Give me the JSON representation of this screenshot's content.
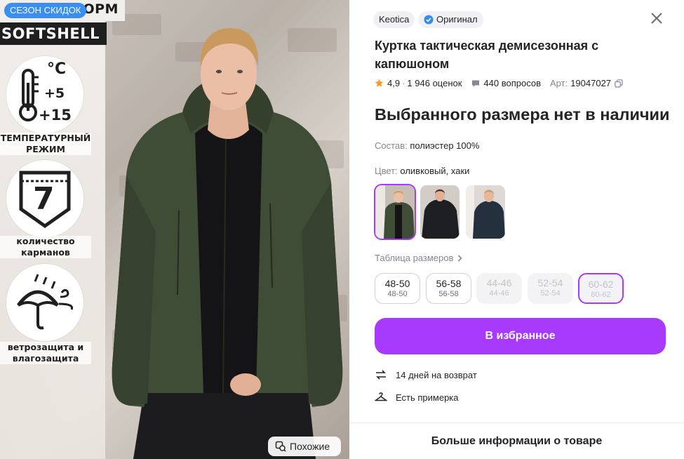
{
  "image": {
    "sale_badge": "СЕЗОН СКИДОК",
    "brand_text": "ТОРМ",
    "material_banner": "SOFTSHELL",
    "temperature": {
      "unit": "°C",
      "plus_low": "+5",
      "plus_high": "+15",
      "label_line1": "ТЕМПЕРАТУРНЫЙ",
      "label_line2": "РЕЖИМ"
    },
    "pockets": {
      "number": "7",
      "label_line1": "количество",
      "label_line2": "карманов"
    },
    "protection": {
      "label_line1": "ветрозащита и",
      "label_line2": "влагозащита"
    },
    "similar_button": "Похожие",
    "jacket_color": "#3f4c36"
  },
  "product": {
    "brand": "Keotica",
    "original_badge": "Оригинал",
    "title": "Куртка тактическая демисезонная с капюшоном",
    "rating": "4,9",
    "reviews": "1 946 оценок",
    "questions": "440 вопросов",
    "article_label": "Арт:",
    "article": "19047027",
    "stock_status": "Выбранного размера нет в наличии",
    "composition_label": "Состав:",
    "composition": "полиэстер 100%",
    "color_label": "Цвет:",
    "color_value": "оливковый, хаки",
    "size_table": "Таблица размеров",
    "sizes": [
      {
        "main": "48-50",
        "sub": "48-50",
        "available": true
      },
      {
        "main": "56-58",
        "sub": "56-58",
        "available": true
      },
      {
        "main": "44-46",
        "sub": "44-46",
        "available": false
      },
      {
        "main": "52-54",
        "sub": "52-54",
        "available": false
      },
      {
        "main": "60-62",
        "sub": "60-62",
        "available": false,
        "selected": true
      }
    ],
    "favorite_button": "В избранное",
    "return_policy": "14 дней на возврат",
    "fitting": "Есть примерка",
    "more_info": "Больше информации о товаре"
  },
  "colors": {
    "accent": "#a73afd",
    "badge_blue": "#3b8ef0",
    "star": "#ff9b1a"
  }
}
